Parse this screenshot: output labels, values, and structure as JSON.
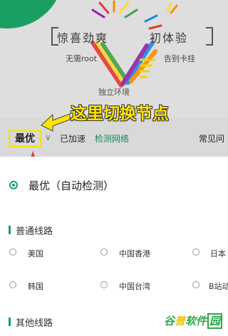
{
  "banner": {
    "slogan_part1": "惊喜劲爽",
    "slogan_part2": "初体验",
    "sub_left": "无需root",
    "sub_right": "告别卡挂",
    "sub_center": "独立环境"
  },
  "annotation": {
    "text": "这里切换节点",
    "color": "#ffe400"
  },
  "tabbar": {
    "best_tab": "最优",
    "accelerated": "已加速",
    "detect_network": "检测网络",
    "faq": "常见问"
  },
  "options": {
    "best_auto": "最优（自动检测）",
    "general_title": "普通线路",
    "general": [
      "美国",
      "中国香港",
      "日本",
      "韩国",
      "中国台湾",
      "B站动"
    ],
    "other_title": "其他线路"
  },
  "watermark": {
    "part1": "谷",
    "part2": "普",
    "part3": "软件",
    "part4": "园"
  },
  "colors": {
    "accent_green": "#1a9f63",
    "highlight_yellow": "#f0e400"
  }
}
